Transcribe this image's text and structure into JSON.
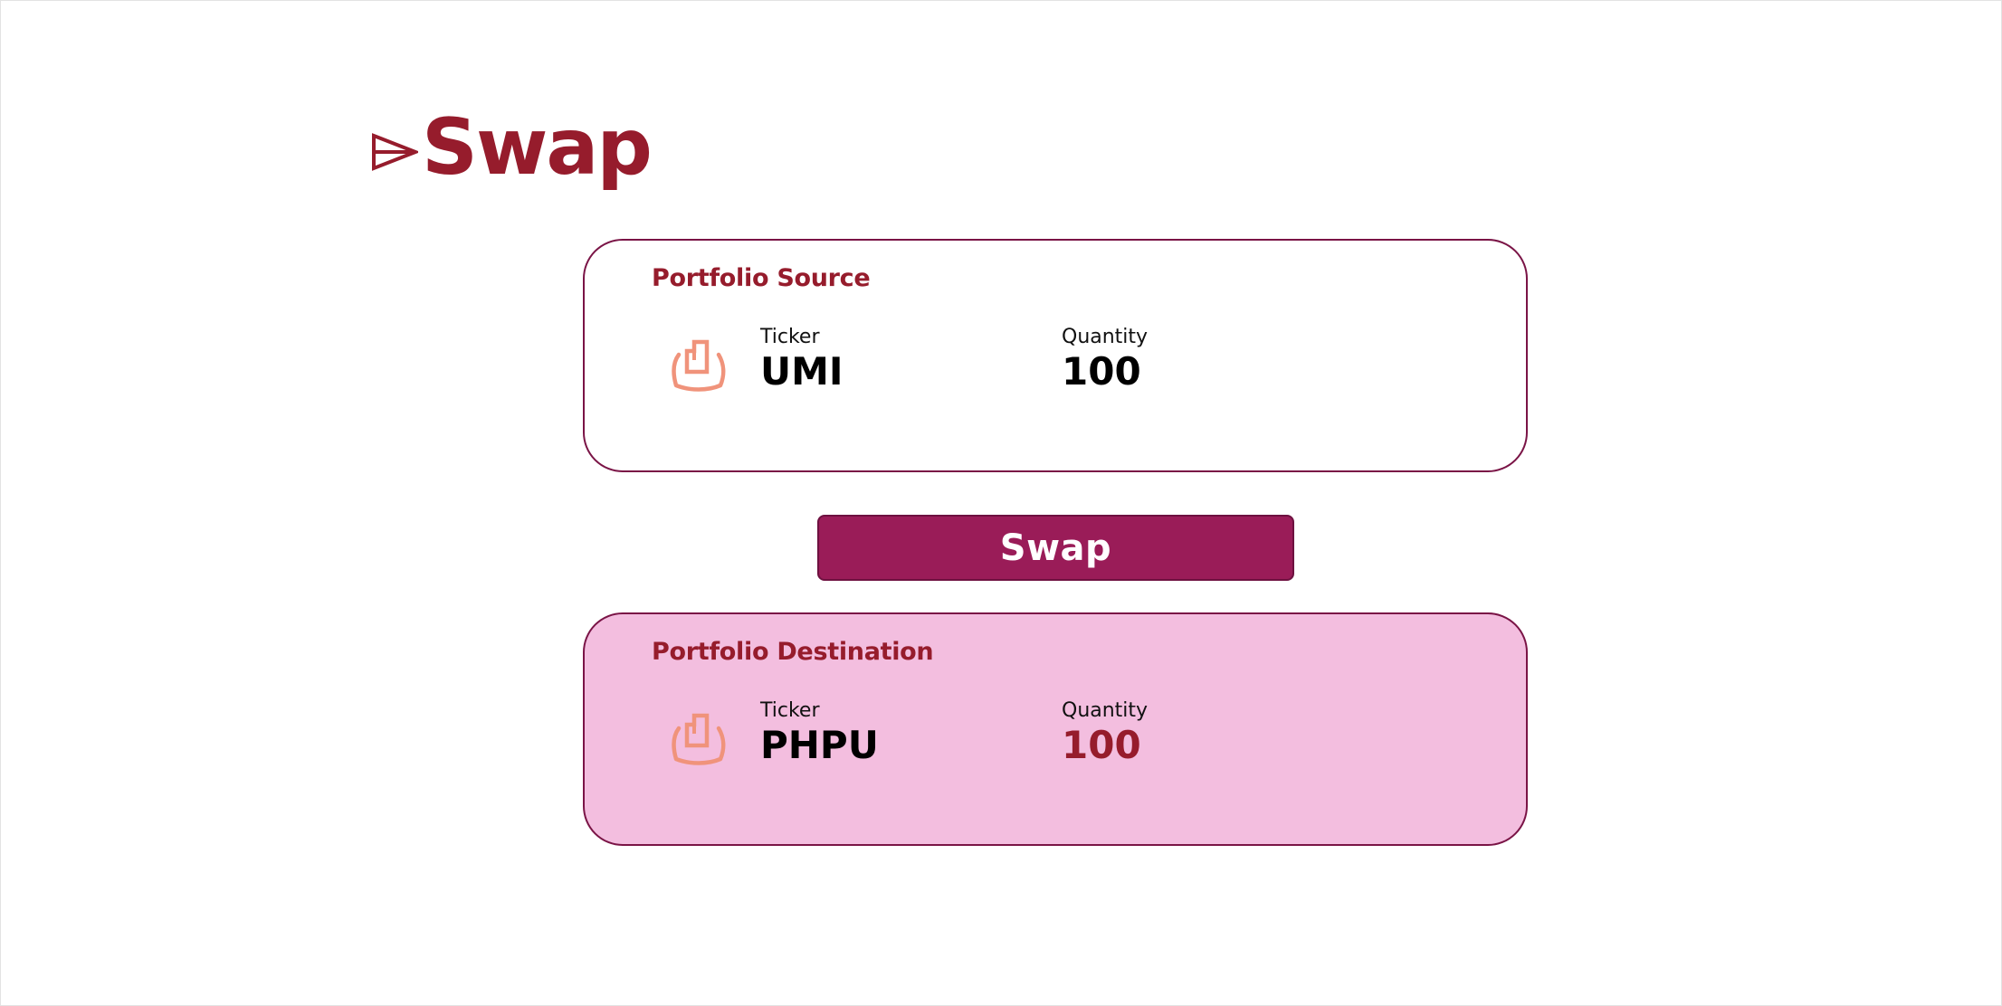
{
  "header": {
    "title": "Swap",
    "icon": "paper-plane-icon"
  },
  "source": {
    "title": "Portfolio Source",
    "icon": "hand-holding-document-icon",
    "ticker_label": "Ticker",
    "ticker": "UMI",
    "quantity_label": "Quantity",
    "quantity": "100"
  },
  "action": {
    "swap_label": "Swap"
  },
  "destination": {
    "title": "Portfolio Destination",
    "icon": "hand-holding-document-icon",
    "ticker_label": "Ticker",
    "ticker": "PHPU",
    "quantity_label": "Quantity",
    "quantity": "100"
  },
  "colors": {
    "brand": "#961c2c",
    "button": "#9a1c58",
    "card_border": "#7a1446",
    "destination_bg": "#f3bedf",
    "icon": "#f0937b",
    "destination_quantity": "#961c2c",
    "value_text": "#000000"
  }
}
